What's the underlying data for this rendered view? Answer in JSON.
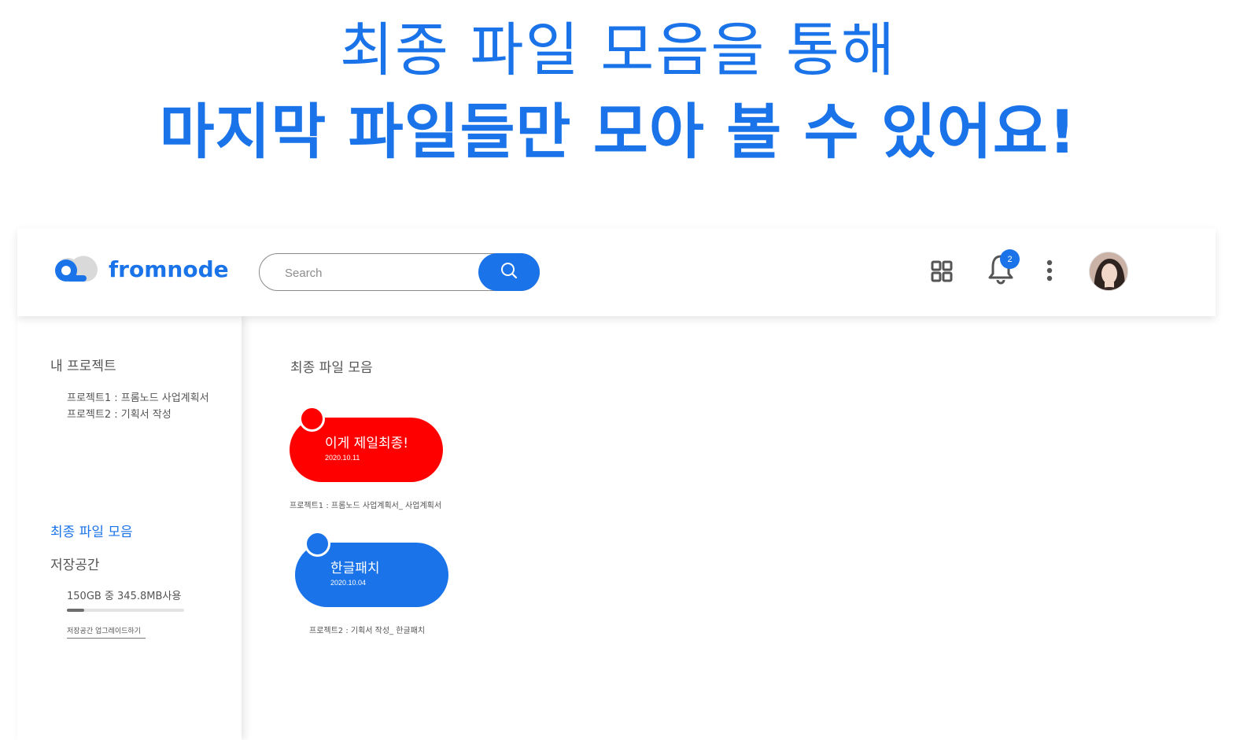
{
  "headline": {
    "line1": "최종 파일 모음을 통해",
    "line2": "마지막 파일들만 모아 볼 수 있어요!"
  },
  "header": {
    "logo_text": "fromnode",
    "search_placeholder": "Search",
    "notification_count": "2",
    "icons": [
      "cloud-logo-icon",
      "search-icon",
      "grid-icon",
      "bell-icon",
      "more-vertical-icon",
      "avatar"
    ]
  },
  "sidebar": {
    "my_projects_title": "내 프로젝트",
    "projects": [
      {
        "label": "프로젝트1 : 프롬노드 사업계획서"
      },
      {
        "label": "프로젝트2 : 기획서 작성"
      }
    ],
    "final_files_label": "최종 파일 모음",
    "storage_title": "저장공간",
    "storage_usage": "150GB 중 345.8MB사용",
    "storage_fill_fraction": 0.15,
    "upgrade_label": "저장공간 업그레이드하기"
  },
  "main": {
    "title": "최종 파일 모음",
    "files": [
      {
        "name": "이게 제일최종!",
        "date": "2020.10.11",
        "caption": "프로젝트1 : 프롬노드 사업계획서_ 사업계획서",
        "color": "#ff0000"
      },
      {
        "name": "한글패치",
        "date": "2020.10.04",
        "caption": "프로젝트2 : 기획서 작성_ 한글패치",
        "color": "#1a73e8"
      }
    ]
  },
  "colors": {
    "accent": "#1a73e8",
    "red": "#ff0000"
  }
}
